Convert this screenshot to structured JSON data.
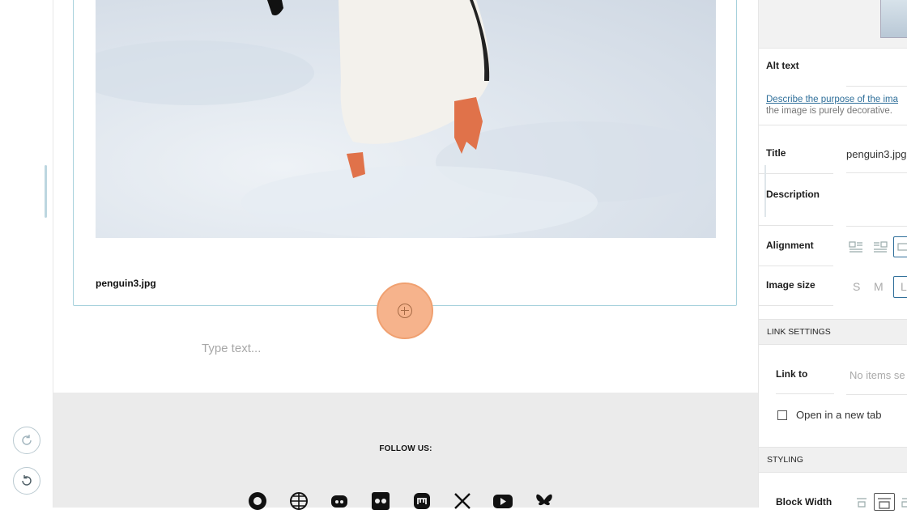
{
  "toolbar": {
    "redo_icon": "redo-icon",
    "undo_icon": "undo-icon"
  },
  "image_block": {
    "caption": "penguin3.jpg",
    "image_alt": "penguin"
  },
  "editor": {
    "text_placeholder": "Type text..."
  },
  "footer": {
    "follow_label": "FOLLOW US:",
    "social_icons": [
      "github-icon",
      "globe-icon",
      "discord-icon",
      "flickr-icon",
      "mastodon-icon",
      "x-icon",
      "youtube-icon",
      "bluesky-icon"
    ]
  },
  "panel": {
    "alt_text_label": "Alt text",
    "alt_text_link": "Describe the purpose of the ima",
    "alt_text_hint": "the image is purely decorative.",
    "title_label": "Title",
    "title_value": "penguin3.jpg",
    "description_label": "Description",
    "alignment_label": "Alignment",
    "image_size_label": "Image size",
    "image_size_options": [
      "S",
      "M",
      "L"
    ],
    "link_settings_header": "LINK SETTINGS",
    "link_to_label": "Link to",
    "link_to_placeholder": "No items se",
    "new_tab_label": "Open in a new tab",
    "styling_header": "STYLING",
    "block_width_label": "Block Width"
  }
}
